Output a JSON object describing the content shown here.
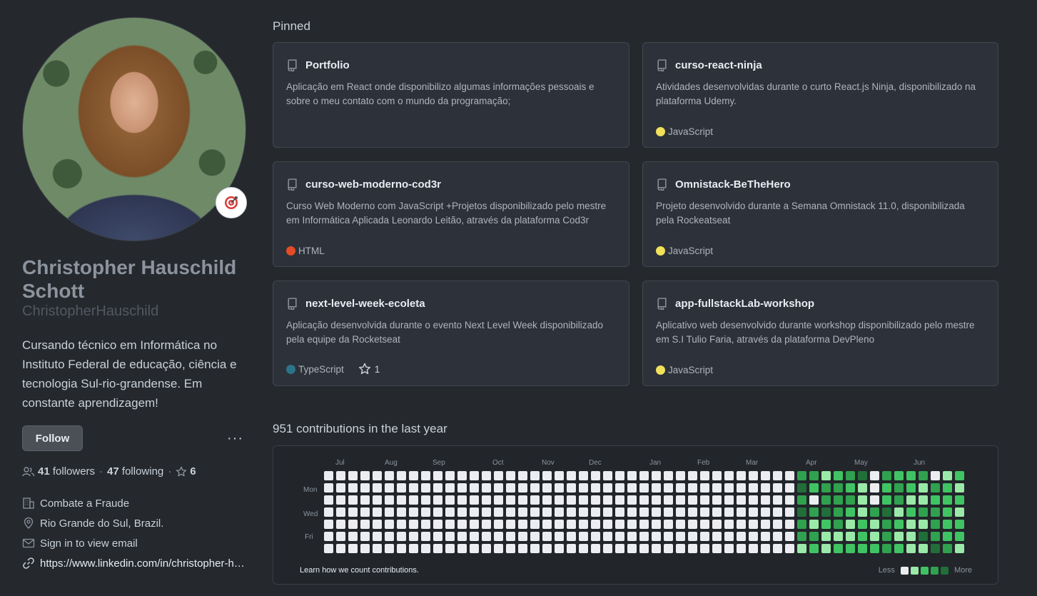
{
  "profile": {
    "full_name": "Christopher Hauschild Schott",
    "username": "ChristopherHauschild",
    "bio": "Cursando técnico em Informática no Instituto Federal de educação, ciência e tecnologia Sul-rio-grandense. Em constante aprendizagem!",
    "follow_label": "Follow",
    "more_label": "···",
    "followers_count": "41",
    "followers_label": "followers",
    "following_count": "47",
    "following_label": "following",
    "stars_count": "6",
    "company": "Combate a Fraude",
    "location": "Rio Grande do Sul, Brazil.",
    "email": "Sign in to view email",
    "website": "https://www.linkedin.com/in/christopher-hauschild-schott"
  },
  "pinned": {
    "title": "Pinned",
    "items": [
      {
        "name": "Portfolio",
        "description": "Aplicação em React onde disponibilizo algumas informações pessoais e sobre o meu contato com o mundo da programação;",
        "language": "",
        "language_color": "",
        "stars": ""
      },
      {
        "name": "curso-react-ninja",
        "description": "Atividades desenvolvidas durante o curto React.js Ninja, disponibilizado na plataforma Udemy.",
        "language": "JavaScript",
        "language_color": "#f1e05a",
        "stars": ""
      },
      {
        "name": "curso-web-moderno-cod3r",
        "description": "Curso Web Moderno com JavaScript +Projetos disponibilizado pelo mestre em Informática Aplicada Leonardo Leitão, através da plataforma Cod3r",
        "language": "HTML",
        "language_color": "#e34c26",
        "stars": ""
      },
      {
        "name": "Omnistack-BeTheHero",
        "description": "Projeto desenvolvido durante a Semana Omnistack 11.0, disponibilizada pela Rockeatseat",
        "language": "JavaScript",
        "language_color": "#f1e05a",
        "stars": ""
      },
      {
        "name": "next-level-week-ecoleta",
        "description": "Aplicação desenvolvida durante o evento Next Level Week disponibilizado pela equipe da Rocketseat",
        "language": "TypeScript",
        "language_color": "#2b7489",
        "stars": "1"
      },
      {
        "name": "app-fullstackLab-workshop",
        "description": "Aplicativo web desenvolvido durante workshop disponibilizado pelo mestre em S.I Tulio Faria, através da plataforma DevPleno",
        "language": "JavaScript",
        "language_color": "#f1e05a",
        "stars": ""
      }
    ]
  },
  "contributions": {
    "title": "951 contributions in the last year",
    "months": [
      "Jul",
      "Aug",
      "Sep",
      "Oct",
      "Nov",
      "Dec",
      "Jan",
      "Feb",
      "Mar",
      "Apr",
      "May",
      "Jun"
    ],
    "days": [
      "Mon",
      "Wed",
      "Fri"
    ],
    "learn_label": "Learn how we count contributions.",
    "legend_less": "Less",
    "legend_more": "More",
    "colors": [
      "#ebedf0",
      "#9be9a8",
      "#40c463",
      "#30a14e",
      "#216e39"
    ],
    "recent_weeks": [
      [
        3,
        4,
        3,
        4,
        3,
        3,
        1
      ],
      [
        3,
        2,
        0,
        3,
        1,
        3,
        2
      ],
      [
        1,
        3,
        3,
        4,
        2,
        1,
        1
      ],
      [
        2,
        3,
        3,
        3,
        3,
        1,
        2
      ],
      [
        3,
        2,
        3,
        2,
        1,
        1,
        2
      ],
      [
        4,
        1,
        1,
        1,
        2,
        2,
        2
      ],
      [
        0,
        0,
        0,
        3,
        1,
        1,
        2
      ],
      [
        3,
        2,
        2,
        4,
        3,
        3,
        3
      ],
      [
        2,
        3,
        3,
        1,
        2,
        1,
        2
      ],
      [
        2,
        2,
        1,
        2,
        1,
        1,
        1
      ],
      [
        3,
        1,
        1,
        3,
        1,
        4,
        1
      ],
      [
        0,
        3,
        2,
        3,
        3,
        3,
        4
      ],
      [
        1,
        2,
        2,
        2,
        2,
        2,
        3
      ],
      [
        2,
        1,
        2,
        1,
        2,
        2,
        1
      ]
    ]
  }
}
